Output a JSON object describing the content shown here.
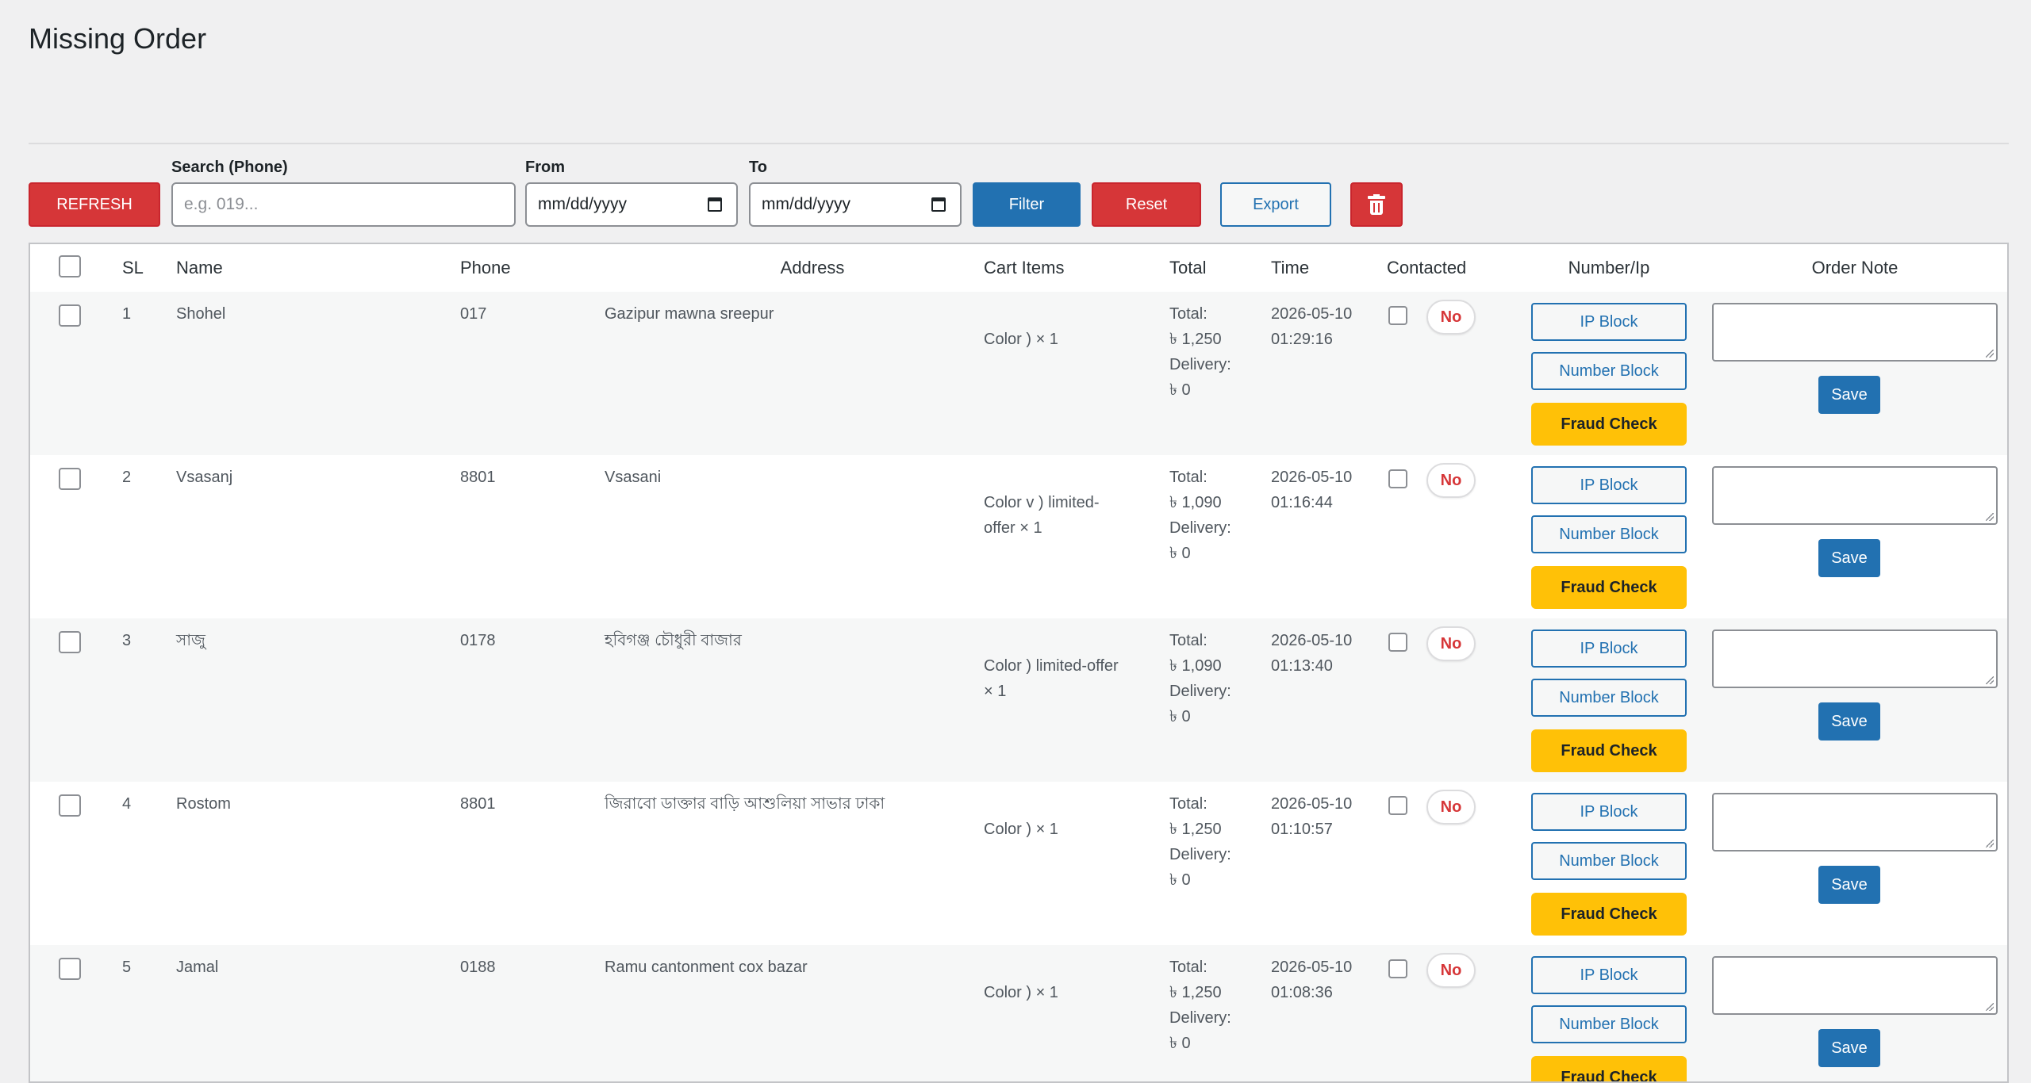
{
  "page": {
    "title": "Missing Order"
  },
  "toolbar": {
    "refresh_label": "REFRESH",
    "search_label": "Search (Phone)",
    "search_placeholder": "e.g. 019...",
    "from_label": "From",
    "from_value": "mm/dd/yyyy",
    "to_label": "To",
    "to_value": "mm/dd/yyyy",
    "filter_label": "Filter",
    "reset_label": "Reset",
    "export_label": "Export",
    "delete_icon": "trash-icon"
  },
  "table": {
    "headers": {
      "sl": "SL",
      "name": "Name",
      "phone": "Phone",
      "address": "Address",
      "cart": "Cart Items",
      "total": "Total",
      "time": "Time",
      "contacted": "Contacted",
      "number_ip": "Number/Ip",
      "order_note": "Order Note"
    },
    "rows": [
      {
        "sl": "1",
        "name": "Shohel",
        "phone": "017",
        "address": "Gazipur mawna sreepur",
        "cart": [
          "Color ) × 1"
        ],
        "total": [
          "Total:",
          "৳ 1,250",
          "Delivery:",
          "৳ 0"
        ],
        "time": [
          "2026-05-10",
          "01:29:16"
        ],
        "contacted": "No",
        "ip_block": "IP Block",
        "number_block": "Number Block",
        "fraud_check": "Fraud Check",
        "save": "Save"
      },
      {
        "sl": "2",
        "name": "Vsasanj",
        "phone": "8801",
        "address": "Vsasani",
        "cart": [
          "Color v ) limited-",
          "offer × 1"
        ],
        "total": [
          "Total:",
          "৳ 1,090",
          "Delivery:",
          "৳ 0"
        ],
        "time": [
          "2026-05-10",
          "01:16:44"
        ],
        "contacted": "No",
        "ip_block": "IP Block",
        "number_block": "Number Block",
        "fraud_check": "Fraud Check",
        "save": "Save"
      },
      {
        "sl": "3",
        "name": "সাজু",
        "phone": "0178",
        "address": "হবিগঞ্জ চৌধুরী বাজার",
        "cart": [
          "Color ) limited-offer",
          "× 1"
        ],
        "total": [
          "Total:",
          "৳ 1,090",
          "Delivery:",
          "৳ 0"
        ],
        "time": [
          "2026-05-10",
          "01:13:40"
        ],
        "contacted": "No",
        "ip_block": "IP Block",
        "number_block": "Number Block",
        "fraud_check": "Fraud Check",
        "save": "Save"
      },
      {
        "sl": "4",
        "name": "Rostom",
        "phone": "8801",
        "address": "জিরাবো ডাক্তার বাড়ি আশুলিয়া সাভার ঢাকা",
        "cart": [
          "Color ) × 1"
        ],
        "total": [
          "Total:",
          "৳ 1,250",
          "Delivery:",
          "৳ 0"
        ],
        "time": [
          "2026-05-10",
          "01:10:57"
        ],
        "contacted": "No",
        "ip_block": "IP Block",
        "number_block": "Number Block",
        "fraud_check": "Fraud Check",
        "save": "Save"
      },
      {
        "sl": "5",
        "name": "Jamal",
        "phone": "0188",
        "address": "Ramu cantonment cox bazar",
        "cart": [
          "Color ) × 1"
        ],
        "total": [
          "Total:",
          "৳ 1,250",
          "Delivery:",
          "৳ 0"
        ],
        "time": [
          "2026-05-10",
          "01:08:36"
        ],
        "contacted": "No",
        "ip_block": "IP Block",
        "number_block": "Number Block",
        "fraud_check": "Fraud Check",
        "save": "Save"
      }
    ]
  },
  "colors": {
    "primary": "#2271b1",
    "danger": "#d63638",
    "warning": "#ffc107",
    "background": "#f0f0f1"
  }
}
